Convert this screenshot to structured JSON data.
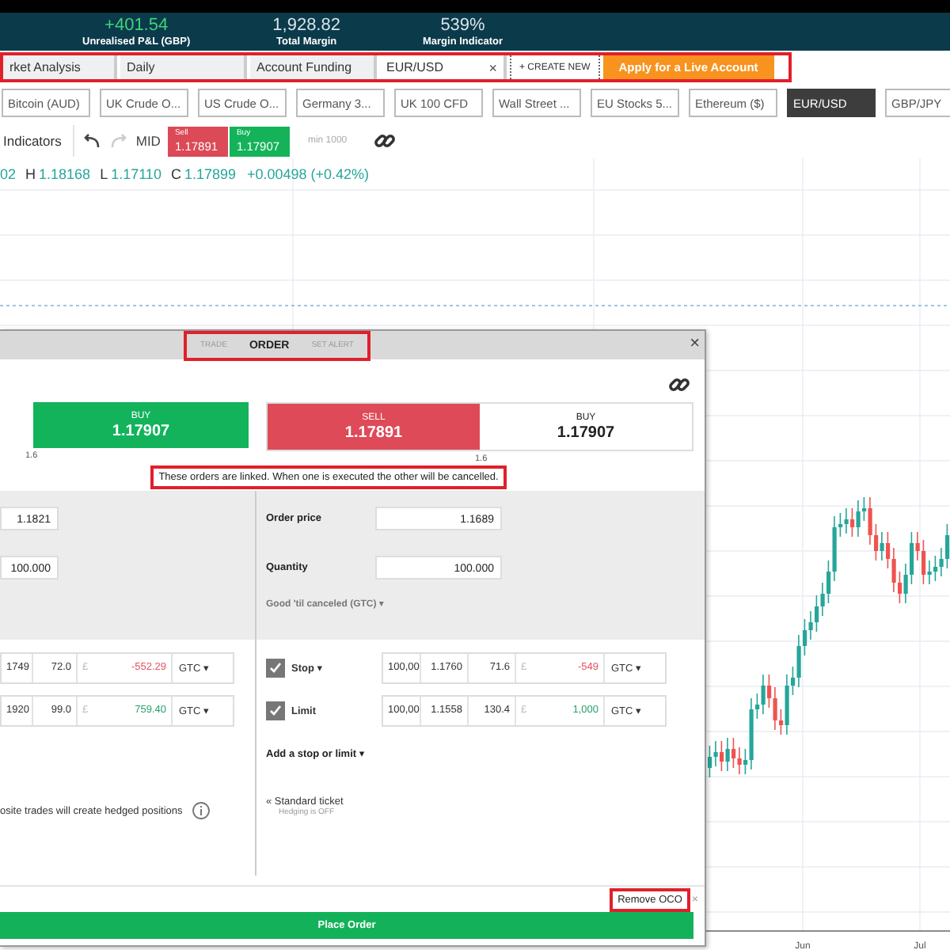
{
  "header": {
    "stats": [
      {
        "value": "+401.54",
        "label": "Unrealised P&L (GBP)",
        "kind": "positive"
      },
      {
        "value": "1,928.82",
        "label": "Total Margin",
        "kind": "neutral"
      },
      {
        "value": "539%",
        "label": "Margin Indicator",
        "kind": "neutral"
      }
    ]
  },
  "workspace_tabs": [
    {
      "label": "rket Analysis",
      "selected": false
    },
    {
      "label": "Daily",
      "selected": false
    },
    {
      "label": "Account Funding",
      "selected": false
    },
    {
      "label": "EUR/USD",
      "selected": true,
      "close": "×"
    }
  ],
  "create_new": "+ CREATE NEW",
  "live_account": "Apply for a Live Account",
  "markets": [
    {
      "label": "Bitcoin (AUD)",
      "selected": false
    },
    {
      "label": "UK Crude O...",
      "selected": false
    },
    {
      "label": "US Crude O...",
      "selected": false
    },
    {
      "label": "Germany 3...",
      "selected": false
    },
    {
      "label": "UK 100 CFD",
      "selected": false
    },
    {
      "label": "Wall Street ...",
      "selected": false
    },
    {
      "label": "EU Stocks 5...",
      "selected": false
    },
    {
      "label": "Ethereum ($)",
      "selected": false
    },
    {
      "label": "EUR/USD",
      "selected": true
    },
    {
      "label": "GBP/JPY",
      "selected": false
    }
  ],
  "toolbar": {
    "indicators": "Indicators",
    "mid": "MID",
    "sell": {
      "label": "Sell",
      "price": "1.17891"
    },
    "buy": {
      "label": "Buy",
      "price": "1.17907"
    },
    "min": "min 1000"
  },
  "ohlc": {
    "open": "02",
    "items": [
      {
        "label": "H",
        "value": "1.18168"
      },
      {
        "label": "L",
        "value": "1.17110"
      },
      {
        "label": "C",
        "value": "1.17899"
      }
    ],
    "change": "+0.00498 (+0.42%)"
  },
  "chart": {
    "x_labels": [
      "Jun",
      "Jul"
    ]
  },
  "ticket": {
    "tabs": [
      {
        "label": "TRADE",
        "selected": false
      },
      {
        "label": "ORDER",
        "selected": true
      },
      {
        "label": "SET ALERT",
        "selected": false
      }
    ],
    "close": "×",
    "left_price": {
      "side": "BUY",
      "price": "1.17907",
      "note": "1.6"
    },
    "right_prices": [
      {
        "side": "SELL",
        "price": "1.17891",
        "kind": "sell"
      },
      {
        "side": "BUY",
        "price": "1.17907",
        "kind": "buy"
      }
    ],
    "right_note": "1.6",
    "message": "These orders are linked. When one is executed the other will be cancelled.",
    "left": {
      "order_price": "1.1821",
      "quantity": "100.000",
      "rows": [
        {
          "cells": [
            "1749",
            "72.0",
            "£",
            "-552.29"
          ],
          "loss": true,
          "expiry": "GTC ▾"
        },
        {
          "cells": [
            "1920",
            "99.0",
            "£",
            "759.40"
          ],
          "loss": false,
          "expiry": "GTC ▾"
        }
      ],
      "hedge_note": "osite trades will create hedged positions"
    },
    "right": {
      "order_price_label": "Order price",
      "order_price": "1.1689",
      "quantity_label": "Quantity",
      "quantity": "100.000",
      "expiry": "Good 'til canceled (GTC) ▾",
      "rows": [
        {
          "label": "Stop ▾",
          "checked": true,
          "cells": [
            "100,00",
            "1.1760",
            "71.6",
            "£",
            "-549"
          ],
          "loss": true,
          "expiry": "GTC ▾"
        },
        {
          "label": "Limit",
          "checked": true,
          "cells": [
            "100,00",
            "1.1558",
            "130.4",
            "£",
            "1,000"
          ],
          "loss": false,
          "expiry": "GTC ▾"
        }
      ],
      "add": "Add a stop or limit ▾",
      "standard": "« Standard ticket",
      "hedging": "Hedging is OFF"
    },
    "remove_oco": "Remove OCO",
    "remove_close": "×",
    "place_order": "Place Order"
  }
}
